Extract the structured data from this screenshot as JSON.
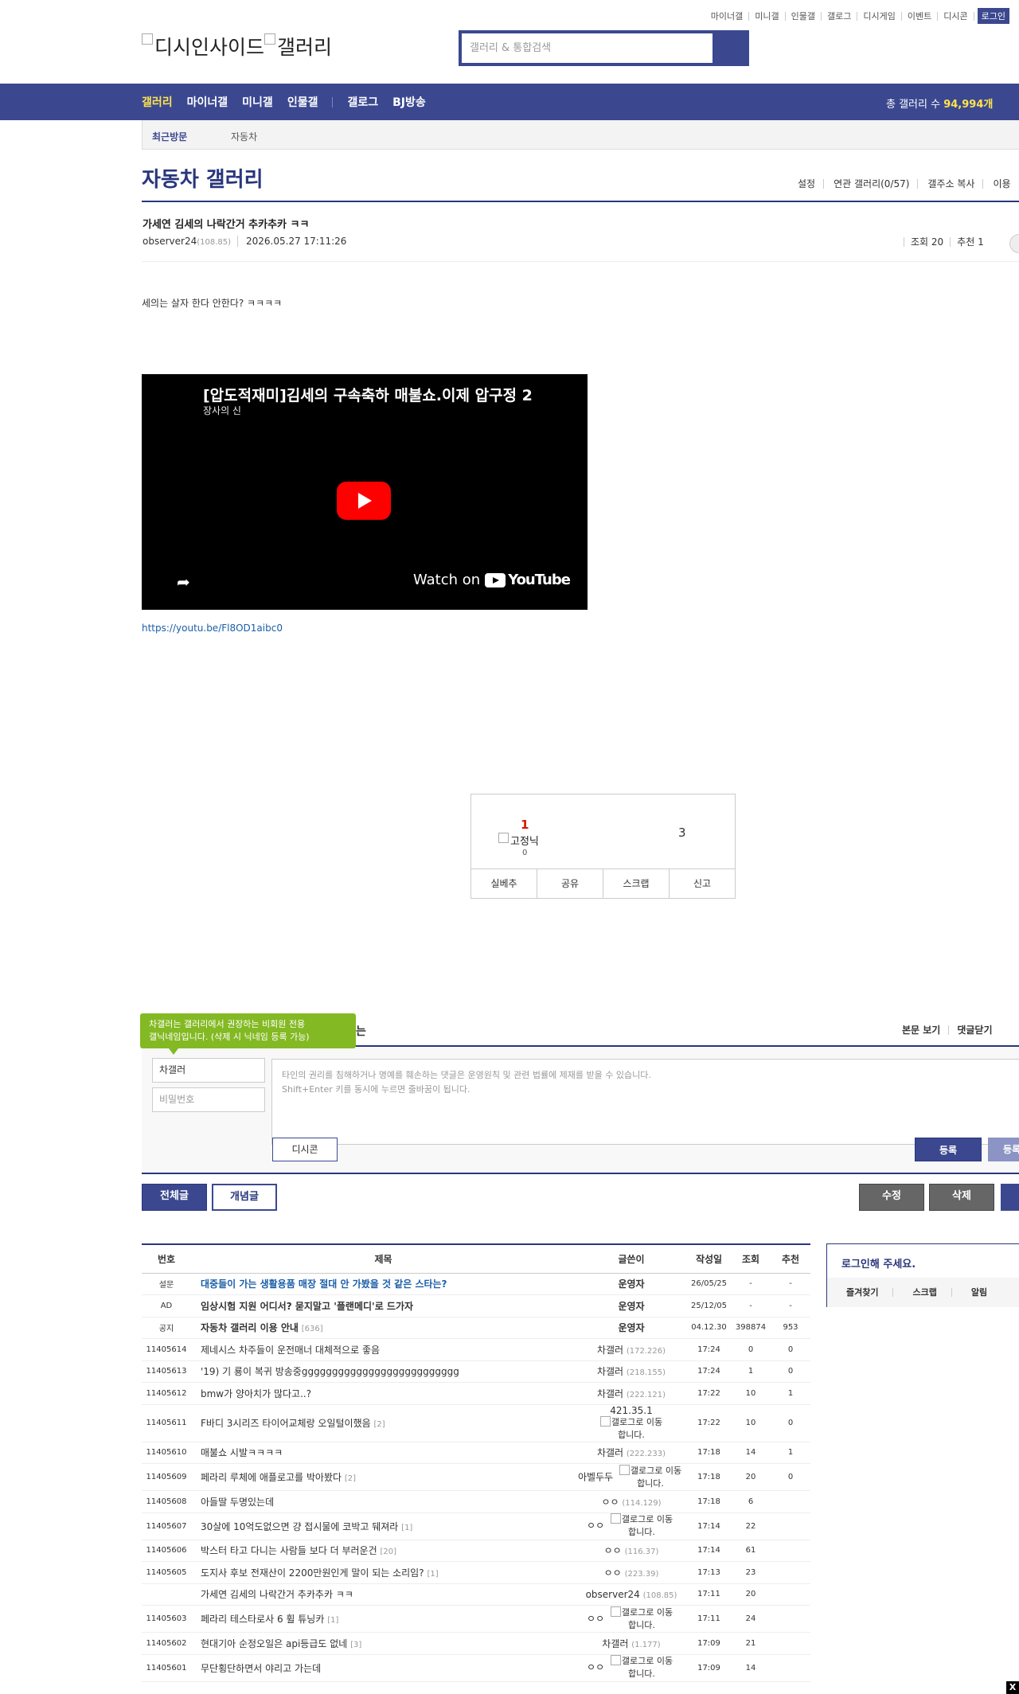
{
  "top_links": [
    "마이너갤",
    "미니갤",
    "인물갤",
    "갤로그",
    "디시게임",
    "이벤트",
    "디시콘"
  ],
  "login_label": "로그인",
  "logo": {
    "part1": "디시인사이드",
    "part2": "갤러리"
  },
  "search": {
    "placeholder": "갤러리 & 통합검색"
  },
  "gnb": {
    "items": [
      "갤러리",
      "마이너갤",
      "미니갤",
      "인물갤",
      "갤로그",
      "BJ방송"
    ],
    "total_label": "총 갤러리 수",
    "total_count": "94,994개"
  },
  "recent_visit": {
    "label": "최근방문",
    "item": "자동차"
  },
  "gallery": {
    "title": "자동차 갤러리",
    "menu": [
      "설정",
      "연관 갤러리(0/57)",
      "갤주소 복사",
      "이용"
    ]
  },
  "post": {
    "title": "가세연 김세의 나락간거 추카추카 ㅋㅋ",
    "author": "observer24",
    "author_ip": "(108.85)",
    "date": "2026.05.27 17:11:26",
    "views": "조회 20",
    "recommend": "추천 1",
    "body": "세의는 살자 한다 안한다? ㅋㅋㅋㅋ",
    "link": "https://youtu.be/Fl8OD1aibc0"
  },
  "video": {
    "title": "[압도적재미]김세의 구속축하 매불쇼.이제 압구정 2",
    "channel": "장사의 신",
    "watch_on": "Watch on",
    "brand": "YouTube"
  },
  "recommend_box": {
    "up_count": "1",
    "fixed_nick_img": "고정닉",
    "fixed_count": "0",
    "down_count": "3",
    "buttons": [
      "실베추",
      "공유",
      "스크랩",
      "신고"
    ]
  },
  "comment": {
    "tooltip_line1": "차갤러는 갤러리에서 권장하는 비회원 전용",
    "tooltip_line2": "갤닉네임입니다. (삭제 시 닉네임 등록 가능)",
    "tooltip_trail": "는",
    "tools": [
      "본문 보기",
      "댓글닫기"
    ],
    "nick_value": "차갤러",
    "password_placeholder": "비밀번호",
    "notice_line1": "타인의 권리를 침해하거나 명예를 훼손하는 댓글은 운영원칙 및 관련 법률에 제재를 받을 수 있습니다.",
    "notice_line2": "Shift+Enter 키를 동시에 누르면 줄바꿈이 됩니다.",
    "dccon_label": "디시콘",
    "register_label": "등록",
    "register2_label": "등록"
  },
  "list_tabs": {
    "all": "전체글",
    "recommended": "개념글",
    "edit": "수정",
    "delete": "삭제"
  },
  "list_headers": [
    "번호",
    "제목",
    "글쓴이",
    "작성일",
    "조회",
    "추천"
  ],
  "gallog_link_text": "갤로그로 이동합니다.",
  "rows": [
    {
      "num": "설문",
      "subject": "대중들이 가는 생활용품 매장 절대 안 가봤을 것 같은 스타는?",
      "reply": "",
      "writer": "운영자",
      "ip": "",
      "date": "26/05/25",
      "views": "-",
      "rec": "-",
      "style": "notice"
    },
    {
      "num": "AD",
      "subject": "임상시험 지원 어디서? 묻지말고 '플랜메디'로 드가자",
      "reply": "",
      "writer": "운영자",
      "ip": "",
      "date": "25/12/05",
      "views": "-",
      "rec": "-",
      "style": "bold"
    },
    {
      "num": "공지",
      "subject": "자동차 갤러리 이용 안내",
      "reply": "[636]",
      "writer": "운영자",
      "ip": "",
      "date": "04.12.30",
      "views": "398874",
      "rec": "953",
      "style": "bold"
    },
    {
      "num": "11405614",
      "subject": "제네시스 차주들이 운전매너 대체적으로 좋음",
      "reply": "",
      "writer": "차갤러",
      "ip": "(172.226)",
      "date": "17:24",
      "views": "0",
      "rec": "0",
      "style": ""
    },
    {
      "num": "11405613",
      "subject": "'19) 기 룡이 복귀 방송중gggggggggggggggggggggggggg",
      "reply": "",
      "writer": "차갤러",
      "ip": "(218.155)",
      "date": "17:24",
      "views": "1",
      "rec": "0",
      "style": ""
    },
    {
      "num": "11405612",
      "subject": "bmw가 양아치가 많다고..?",
      "reply": "",
      "writer": "차갤러",
      "ip": "(222.121)",
      "date": "17:22",
      "views": "10",
      "rec": "1",
      "style": ""
    },
    {
      "num": "11405611",
      "subject": "F바디 3시리즈 타이어교체랑 오일털이했음",
      "reply": "[2]",
      "writer": "421.35.1",
      "ip": "",
      "date": "17:22",
      "views": "10",
      "rec": "0",
      "style": "gallog"
    },
    {
      "num": "11405610",
      "subject": "매불쇼 시발ㅋㅋㅋㅋ",
      "reply": "",
      "writer": "차갤러",
      "ip": "(222.233)",
      "date": "17:18",
      "views": "14",
      "rec": "1",
      "style": ""
    },
    {
      "num": "11405609",
      "subject": "페라리 루체에 애플로고를 박아봤다",
      "reply": "[2]",
      "writer": "아벨두두",
      "ip": "",
      "date": "17:18",
      "views": "20",
      "rec": "0",
      "style": "gallog"
    },
    {
      "num": "11405608",
      "subject": "아들딸 두명있는데",
      "reply": "",
      "writer": "ㅇㅇ",
      "ip": "(114.129)",
      "date": "17:18",
      "views": "6",
      "rec": "",
      "style": ""
    },
    {
      "num": "11405607",
      "subject": "30살에 10억도없으면 걍 접시물에 코박고 뒈져라",
      "reply": "[1]",
      "writer": "ㅇㅇ",
      "ip": "",
      "date": "17:14",
      "views": "22",
      "rec": "",
      "style": "gallog"
    },
    {
      "num": "11405606",
      "subject": "박스터 타고 다니는 사람들 보다 더 부러운건",
      "reply": "[20]",
      "writer": "ㅇㅇ",
      "ip": "(116.37)",
      "date": "17:14",
      "views": "61",
      "rec": "",
      "style": ""
    },
    {
      "num": "11405605",
      "subject": "도지사 후보 전재산이 2200만원인게 말이 되는 소리임?",
      "reply": "[1]",
      "writer": "ㅇㅇ",
      "ip": "(223.39)",
      "date": "17:13",
      "views": "23",
      "rec": "",
      "style": ""
    },
    {
      "num": "",
      "subject": "가세연 김세의 나락간거 추카추카 ㅋㅋ",
      "reply": "",
      "writer": "observer24",
      "ip": "(108.85)",
      "date": "17:11",
      "views": "20",
      "rec": "",
      "style": ""
    },
    {
      "num": "11405603",
      "subject": "페라리 테스타로사 6 휠 튜닝카",
      "reply": "[1]",
      "writer": "ㅇㅇ",
      "ip": "",
      "date": "17:11",
      "views": "24",
      "rec": "",
      "style": "gallog"
    },
    {
      "num": "11405602",
      "subject": "현대기아 순정오일은 api등급도 없네",
      "reply": "[3]",
      "writer": "차갤러",
      "ip": "(1.177)",
      "date": "17:09",
      "views": "21",
      "rec": "",
      "style": ""
    },
    {
      "num": "11405601",
      "subject": "무단횡단하면서 야리고 가는데",
      "reply": "",
      "writer": "ㅇㅇ",
      "ip": "",
      "date": "17:09",
      "views": "14",
      "rec": "",
      "style": "gallog"
    }
  ],
  "login_box": {
    "title": "로그인해 주세요.",
    "items": [
      "즐겨찾기",
      "스크랩",
      "알림"
    ]
  },
  "close_label": "X"
}
